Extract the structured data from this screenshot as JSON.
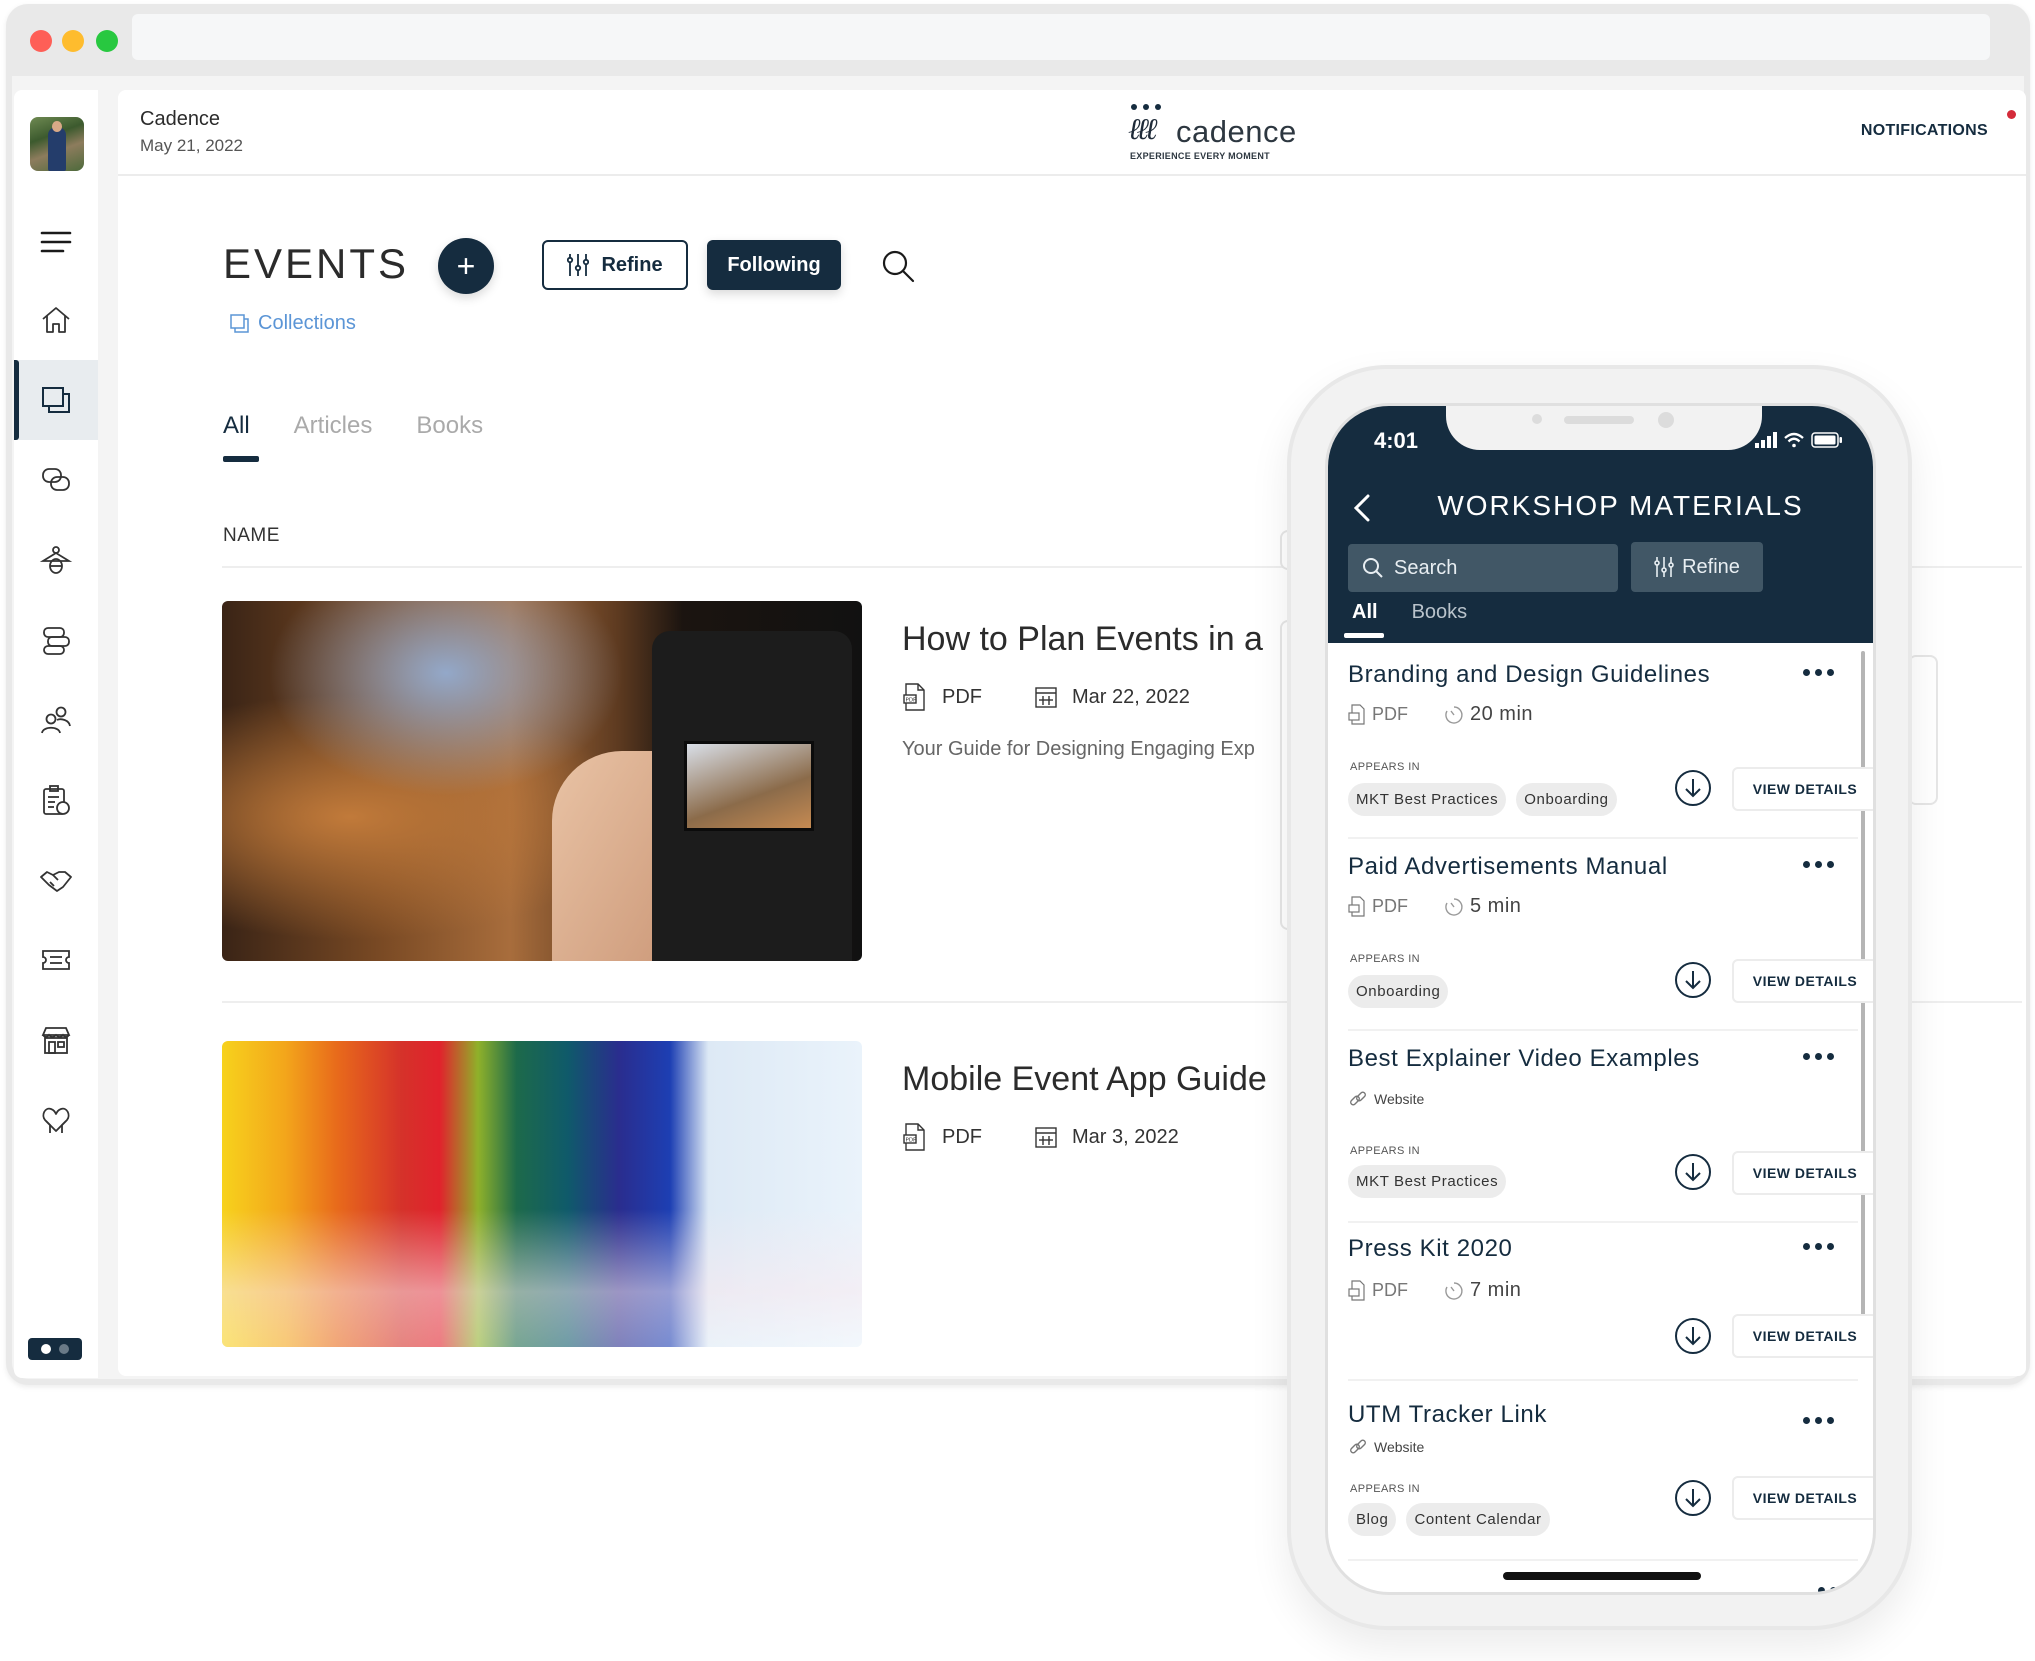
{
  "browser": {
    "traffic_lights": [
      "close",
      "minimize",
      "maximize"
    ],
    "colors": {
      "close": "#fe5f57",
      "minimize": "#febc2e",
      "maximize": "#28c840"
    }
  },
  "sidebar": {
    "items": [
      {
        "name": "menu",
        "icon": "hamburger-menu-icon",
        "active": false
      },
      {
        "name": "home",
        "icon": "home-icon",
        "active": false
      },
      {
        "name": "collections",
        "icon": "collections-icon",
        "active": true
      },
      {
        "name": "chat",
        "icon": "chat-bubbles-icon",
        "active": false
      },
      {
        "name": "firefly",
        "icon": "firefly-icon",
        "active": false
      },
      {
        "name": "signposts",
        "icon": "signpost-icon",
        "active": false
      },
      {
        "name": "people",
        "icon": "people-icon",
        "active": false
      },
      {
        "name": "clipboard",
        "icon": "clipboard-apple-icon",
        "active": false
      },
      {
        "name": "partnerships",
        "icon": "handshake-icon",
        "active": false
      },
      {
        "name": "tickets",
        "icon": "ticket-icon",
        "active": false
      },
      {
        "name": "store",
        "icon": "storefront-icon",
        "active": false
      },
      {
        "name": "care",
        "icon": "heart-hands-icon",
        "active": false
      }
    ],
    "pager": {
      "pages": 2,
      "current": 1
    }
  },
  "header": {
    "app_name": "Cadence",
    "date": "May 21, 2022",
    "logo_text": "cadence",
    "logo_tagline": "EXPERIENCE EVERY MOMENT",
    "notifications_label": "NOTIFICATIONS",
    "has_unread": true
  },
  "page": {
    "title": "EVENTS",
    "add_label": "+",
    "refine_label": "Refine",
    "following_label": "Following",
    "collections_link": "Collections",
    "tabs": [
      {
        "label": "All",
        "active": true
      },
      {
        "label": "Articles",
        "active": false
      },
      {
        "label": "Books",
        "active": false
      }
    ],
    "column_header": "NAME",
    "items": [
      {
        "title": "How to Plan Events in a",
        "type": "PDF",
        "date": "Mar 22, 2022",
        "description": "Your Guide for Designing Engaging Exp",
        "thumbnail": "camera-photo"
      },
      {
        "title": "Mobile Event App Guide",
        "type": "PDF",
        "date": "Mar 3, 2022",
        "description": "",
        "thumbnail": "rainbow-paint-photo"
      }
    ]
  },
  "phone": {
    "status": {
      "time": "4:01"
    },
    "title": "WORKSHOP MATERIALS",
    "search_placeholder": "Search",
    "refine_label": "Refine",
    "tabs": [
      {
        "label": "All",
        "active": true
      },
      {
        "label": "Books",
        "active": false
      }
    ],
    "appears_in_label": "APPEARS IN",
    "view_details_label": "VIEW DETAILS",
    "cards": [
      {
        "title": "Branding and Design Guidelines",
        "type": "PDF",
        "duration": "20 min",
        "appears_in": [
          "MKT Best Practices",
          "Onboarding"
        ]
      },
      {
        "title": "Paid Advertisements Manual",
        "type": "PDF",
        "duration": "5 min",
        "appears_in": [
          "Onboarding"
        ]
      },
      {
        "title": "Best Explainer Video Examples",
        "type": "Website",
        "duration": "",
        "appears_in": [
          "MKT Best Practices"
        ]
      },
      {
        "title": "Press Kit 2020",
        "type": "PDF",
        "duration": "7 min",
        "appears_in": []
      },
      {
        "title": "UTM Tracker Link",
        "type": "Website",
        "duration": "",
        "appears_in": [
          "Blog",
          "Content Calendar"
        ]
      }
    ]
  },
  "colors": {
    "brand_navy": "#152c3f",
    "link_blue": "#5b95d6",
    "notification_dot": "#d42b3a",
    "chip_bg": "#ececec",
    "phone_input_bg": "#415766"
  }
}
